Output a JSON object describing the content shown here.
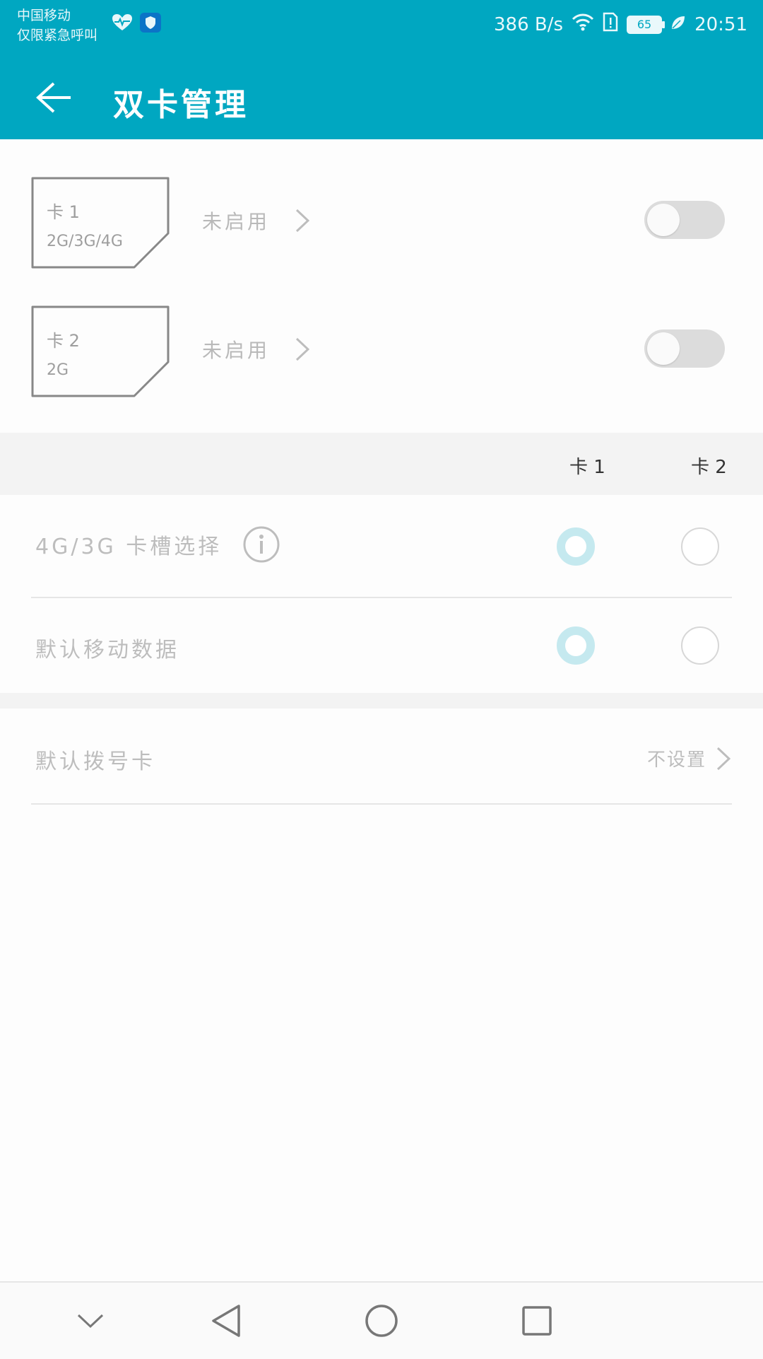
{
  "status_bar": {
    "carrier_line1": "中国移动",
    "carrier_line2": "仅限紧急呼叫",
    "network_speed": "386 B/s",
    "battery_level": "65",
    "time": "20:51"
  },
  "header": {
    "title": "双卡管理"
  },
  "sims": [
    {
      "name": "卡 1",
      "network": "2G/3G/4G",
      "status": "未启用",
      "enabled": false
    },
    {
      "name": "卡 2",
      "network": "2G",
      "status": "未启用",
      "enabled": false
    }
  ],
  "columns": {
    "card1": "卡 1",
    "card2": "卡 2"
  },
  "options": {
    "slot_select": {
      "label": "4G/3G 卡槽选择",
      "selected": "card1"
    },
    "default_data": {
      "label": "默认移动数据",
      "selected": "card1"
    },
    "default_dial": {
      "label": "默认拨号卡",
      "value": "不设置"
    }
  },
  "colors": {
    "accent": "#00a7c1",
    "radio_selected": "#c5e9ef"
  }
}
